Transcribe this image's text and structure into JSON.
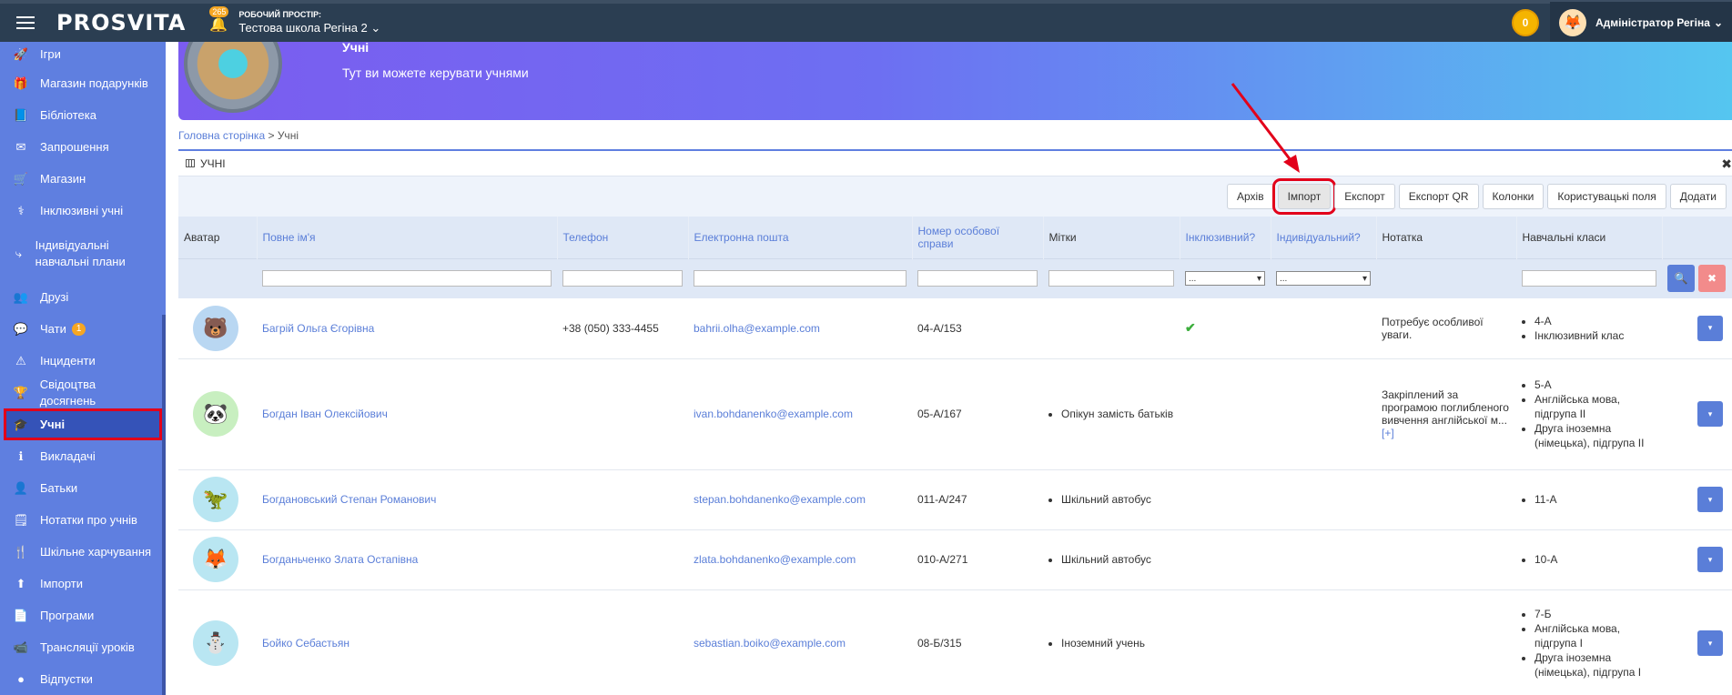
{
  "topbar": {
    "logo": "PROSVITA",
    "notif_count": "265",
    "workspace_label": "Робочий простір:",
    "workspace_value": "Тестова школа Регіна 2",
    "coins": "0",
    "user_name": "Адміністратор Регіна"
  },
  "sidebar": {
    "items": [
      {
        "label": "Ігри",
        "icon": "rocket-icon"
      },
      {
        "label": "Магазин подарунків",
        "icon": "gift-icon"
      },
      {
        "label": "Бібліотека",
        "icon": "book-icon"
      },
      {
        "label": "Запрошення",
        "icon": "envelope-icon"
      },
      {
        "label": "Магазин",
        "icon": "cart-icon"
      },
      {
        "label": "Інклюзивні учні",
        "icon": "stethoscope-icon"
      },
      {
        "label": "Індивідуальні навчальні плани",
        "icon": "route-icon"
      },
      {
        "label": "Друзі",
        "icon": "friends-icon"
      },
      {
        "label": "Чати",
        "icon": "chat-icon",
        "badge": "1"
      },
      {
        "label": "Інциденти",
        "icon": "warning-icon"
      },
      {
        "label": "Свідоцтва досягнень",
        "icon": "trophy-icon"
      },
      {
        "label": "Учні",
        "icon": "graduation-cap-icon"
      },
      {
        "label": "Викладачі",
        "icon": "teacher-icon"
      },
      {
        "label": "Батьки",
        "icon": "parent-icon"
      },
      {
        "label": "Нотатки про учнів",
        "icon": "note-icon"
      },
      {
        "label": "Шкільне харчування",
        "icon": "utensils-icon"
      },
      {
        "label": "Імпорти",
        "icon": "upload-icon"
      },
      {
        "label": "Програми",
        "icon": "program-icon"
      },
      {
        "label": "Трансляції уроків",
        "icon": "video-icon"
      },
      {
        "label": "Відпустки",
        "icon": "circle-icon"
      }
    ]
  },
  "banner": {
    "title": "Учні",
    "subtitle": "Тут ви можете керувати учнями"
  },
  "breadcrumb": {
    "home": "Головна сторінка",
    "separator": " > ",
    "current": "Учні"
  },
  "panel": {
    "title": "УЧНІ",
    "buttons": {
      "archive": "Архів",
      "import": "Імпорт",
      "export": "Експорт",
      "export_qr": "Експорт QR",
      "columns": "Колонки",
      "custom_fields": "Користувацькі поля",
      "add": "Додати"
    }
  },
  "table": {
    "headers": {
      "avatar": "Аватар",
      "name": "Повне ім'я",
      "phone": "Телефон",
      "email": "Електронна пошта",
      "case_number": "Номер особової справи",
      "tags": "Мітки",
      "inclusive": "Інклюзивний?",
      "individual": "Індивідуальний?",
      "note": "Нотатка",
      "classes": "Навчальні класи"
    },
    "filter_select_placeholder": "...",
    "rows": [
      {
        "name": "Багрій Ольга Єгорівна",
        "phone": "+38 (050) 333-4455",
        "email": "bahrii.olha@example.com",
        "case": "04-А/153",
        "tags": [],
        "inclusive": "✔",
        "note": "Потребує особливої уваги.",
        "note_more": "",
        "classes": [
          "4-А",
          "Інклюзивний клас"
        ]
      },
      {
        "name": "Богдан Іван Олексійович",
        "phone": "",
        "email": "ivan.bohdanenko@example.com",
        "case": "05-А/167",
        "tags": [
          "Опікун замість батьків"
        ],
        "inclusive": "",
        "note": "Закріплений за програмою поглибленого вивчення англійської м...",
        "note_more": "[+]",
        "classes": [
          "5-А",
          "Англійська мова, підгрупа II",
          "Друга іноземна (німецька), підгрупа II"
        ]
      },
      {
        "name": "Богдановський Степан Романович",
        "phone": "",
        "email": "stepan.bohdanenko@example.com",
        "case": "011-А/247",
        "tags": [
          "Шкільний автобус"
        ],
        "inclusive": "",
        "note": "",
        "note_more": "",
        "classes": [
          "11-А"
        ]
      },
      {
        "name": "Богданьченко Злата Остапівна",
        "phone": "",
        "email": "zlata.bohdanenko@example.com",
        "case": "010-А/271",
        "tags": [
          "Шкільний автобус"
        ],
        "inclusive": "",
        "note": "",
        "note_more": "",
        "classes": [
          "10-А"
        ]
      },
      {
        "name": "Бойко Себастьян",
        "phone": "",
        "email": "sebastian.boiko@example.com",
        "case": "08-Б/315",
        "tags": [
          "Іноземний учень"
        ],
        "inclusive": "",
        "note": "",
        "note_more": "",
        "classes": [
          "7-Б",
          "Англійська мова, підгрупа I",
          "Друга іноземна (німецька), підгрупа I"
        ]
      }
    ]
  },
  "colors": {
    "sidebar": "#5f7fe0",
    "topbar": "#2b3e52",
    "accent": "#5a7ed8",
    "highlight": "#e2001a"
  }
}
